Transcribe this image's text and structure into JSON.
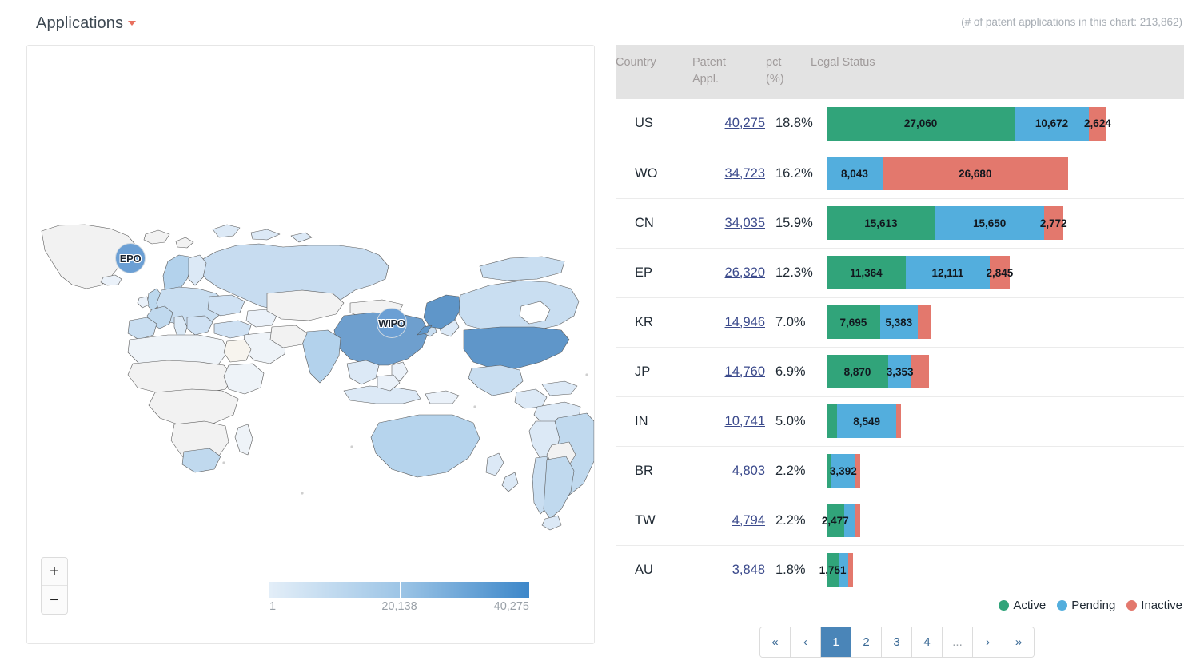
{
  "header": {
    "title": "Applications",
    "dropdown_icon": "caret-down-icon",
    "chart_count_note": "(# of patent applications in this chart: 213,862)"
  },
  "map": {
    "markers": [
      {
        "id": "EPO",
        "label": "EPO"
      },
      {
        "id": "WIPO",
        "label": "WIPO"
      }
    ],
    "zoom_in_label": "+",
    "zoom_out_label": "−",
    "scale": {
      "min": "1",
      "mid": "20,138",
      "max": "40,275"
    }
  },
  "table": {
    "columns": {
      "country": "Country",
      "appl_line1": "Patent",
      "appl_line2": "Appl.",
      "pct_line1": "pct",
      "pct_line2": "(%)",
      "legal_status": "Legal Status"
    },
    "rows": [
      {
        "country": "US",
        "appl": "40,275",
        "pct": "18.8%",
        "segments": [
          {
            "status": "active",
            "label": "27,060",
            "value": 27060
          },
          {
            "status": "pending",
            "label": "10,672",
            "value": 10672
          },
          {
            "status": "inactive",
            "label": "2,624",
            "value": 2543
          }
        ]
      },
      {
        "country": "WO",
        "appl": "34,723",
        "pct": "16.2%",
        "segments": [
          {
            "status": "pending",
            "label": "8,043",
            "value": 8043
          },
          {
            "status": "inactive",
            "label": "26,680",
            "value": 26680
          }
        ]
      },
      {
        "country": "CN",
        "appl": "34,035",
        "pct": "15.9%",
        "segments": [
          {
            "status": "active",
            "label": "15,613",
            "value": 15613
          },
          {
            "status": "pending",
            "label": "15,650",
            "value": 15650
          },
          {
            "status": "inactive",
            "label": "2,772",
            "value": 2772
          }
        ]
      },
      {
        "country": "EP",
        "appl": "26,320",
        "pct": "12.3%",
        "segments": [
          {
            "status": "active",
            "label": "11,364",
            "value": 11364
          },
          {
            "status": "pending",
            "label": "12,111",
            "value": 12111
          },
          {
            "status": "inactive",
            "label": "2,845",
            "value": 2845
          }
        ]
      },
      {
        "country": "KR",
        "appl": "14,946",
        "pct": "7.0%",
        "segments": [
          {
            "status": "active",
            "label": "7,695",
            "value": 7695
          },
          {
            "status": "pending",
            "label": "5,383",
            "value": 5383
          },
          {
            "status": "inactive",
            "label": "",
            "value": 1868
          }
        ]
      },
      {
        "country": "JP",
        "appl": "14,760",
        "pct": "6.9%",
        "segments": [
          {
            "status": "active",
            "label": "8,870",
            "value": 8870
          },
          {
            "status": "pending",
            "label": "3,353",
            "value": 3353
          },
          {
            "status": "inactive",
            "label": "",
            "value": 2537
          }
        ]
      },
      {
        "country": "IN",
        "appl": "10,741",
        "pct": "5.0%",
        "segments": [
          {
            "status": "active",
            "label": "",
            "value": 1500
          },
          {
            "status": "pending",
            "label": "8,549",
            "value": 8549
          },
          {
            "status": "inactive",
            "label": "",
            "value": 692
          }
        ]
      },
      {
        "country": "BR",
        "appl": "4,803",
        "pct": "2.2%",
        "segments": [
          {
            "status": "active",
            "label": "",
            "value": 700
          },
          {
            "status": "pending",
            "label": "3,392",
            "value": 3392
          },
          {
            "status": "inactive",
            "label": "",
            "value": 711
          }
        ]
      },
      {
        "country": "TW",
        "appl": "4,794",
        "pct": "2.2%",
        "segments": [
          {
            "status": "active",
            "label": "2,477",
            "value": 2477
          },
          {
            "status": "pending",
            "label": "",
            "value": 1600
          },
          {
            "status": "inactive",
            "label": "",
            "value": 717
          }
        ]
      },
      {
        "country": "AU",
        "appl": "3,848",
        "pct": "1.8%",
        "segments": [
          {
            "status": "active",
            "label": "1,751",
            "value": 1751
          },
          {
            "status": "pending",
            "label": "",
            "value": 1400
          },
          {
            "status": "inactive",
            "label": "",
            "value": 697
          }
        ]
      }
    ]
  },
  "legend": [
    {
      "key": "active",
      "label": "Active",
      "color": "#31a47a"
    },
    {
      "key": "pending",
      "label": "Pending",
      "color": "#53aedd"
    },
    {
      "key": "inactive",
      "label": "Inactive",
      "color": "#e3786d"
    }
  ],
  "pagination": {
    "items": [
      {
        "label": "«",
        "name": "first",
        "active": false
      },
      {
        "label": "‹",
        "name": "previous",
        "active": false
      },
      {
        "label": "1",
        "name": "page-1",
        "active": true
      },
      {
        "label": "2",
        "name": "page-2",
        "active": false
      },
      {
        "label": "3",
        "name": "page-3",
        "active": false
      },
      {
        "label": "4",
        "name": "page-4",
        "active": false
      },
      {
        "label": "...",
        "name": "ellipsis",
        "active": false
      },
      {
        "label": "›",
        "name": "next",
        "active": false
      },
      {
        "label": "»",
        "name": "last",
        "active": false
      }
    ]
  },
  "chart_data": {
    "type": "bar",
    "title": "Applications by country — Legal Status",
    "orientation": "horizontal-stacked",
    "categories": [
      "US",
      "WO",
      "CN",
      "EP",
      "KR",
      "JP",
      "IN",
      "BR",
      "TW",
      "AU"
    ],
    "series": [
      {
        "name": "Active",
        "values": [
          27060,
          0,
          15613,
          11364,
          7695,
          8870,
          1500,
          700,
          2477,
          1751
        ]
      },
      {
        "name": "Pending",
        "values": [
          10672,
          8043,
          15650,
          12111,
          5383,
          3353,
          8549,
          3392,
          1600,
          1400
        ]
      },
      {
        "name": "Inactive",
        "values": [
          2543,
          26680,
          2772,
          2845,
          1868,
          2537,
          692,
          711,
          717,
          697
        ]
      }
    ],
    "totals": [
      40275,
      34723,
      34035,
      26320,
      14946,
      14760,
      10741,
      4803,
      4794,
      3848
    ],
    "pct": [
      "18.8%",
      "16.2%",
      "15.9%",
      "12.3%",
      "7.0%",
      "6.9%",
      "5.0%",
      "2.2%",
      "2.2%",
      "1.8%"
    ],
    "xlabel": "Patent Appl.",
    "ylabel": "Country",
    "grid": false,
    "legend_position": "bottom-right",
    "total_applications": 213862,
    "map_scale": {
      "min": 1,
      "mid": 20138,
      "max": 40275
    }
  }
}
